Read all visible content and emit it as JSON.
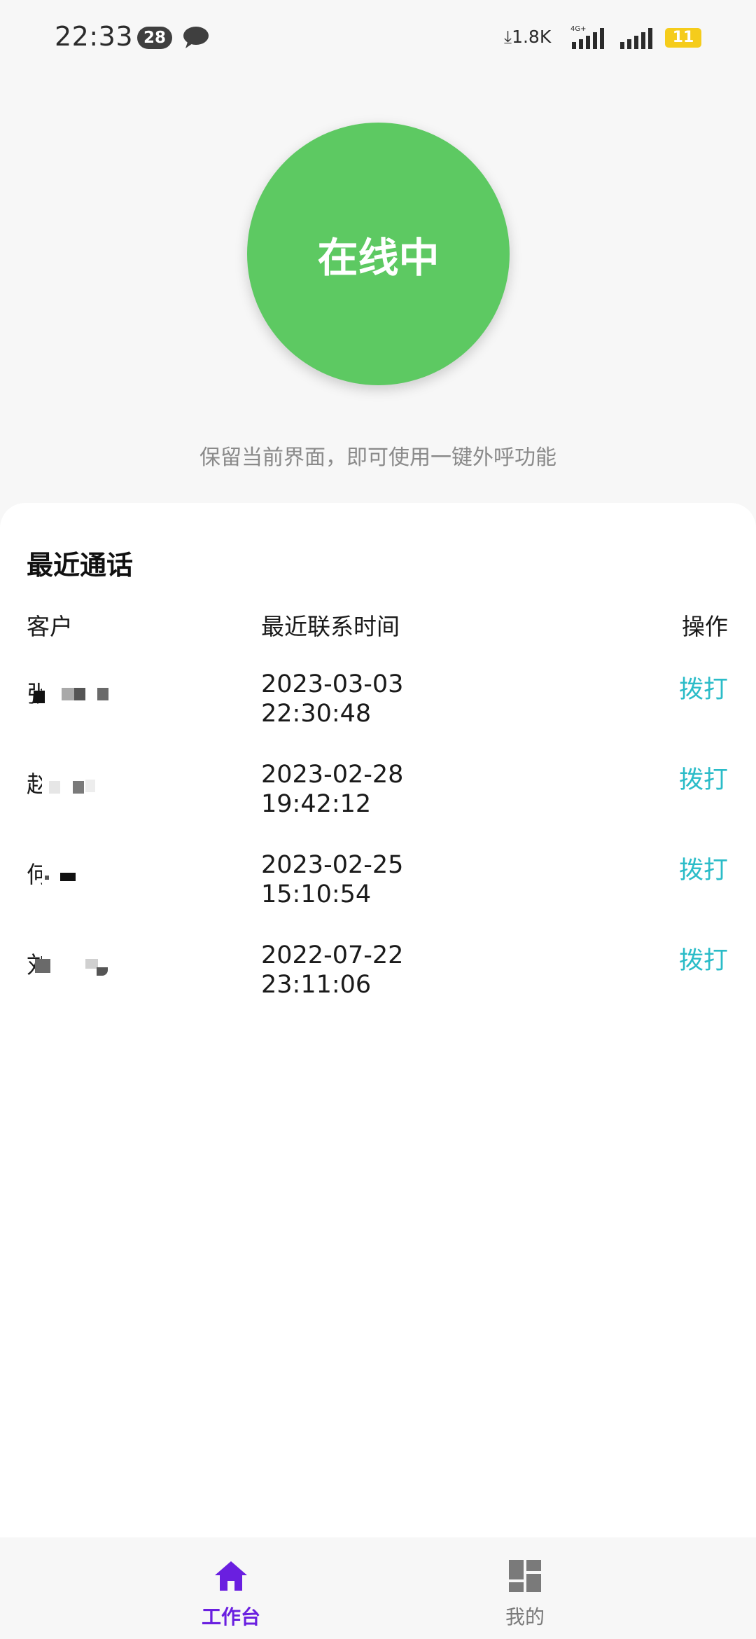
{
  "status_bar": {
    "time": "22:33",
    "notification_count": "28",
    "net_speed": "1.8K",
    "battery": "11"
  },
  "status": {
    "online_label": "在线中",
    "hint": "保留当前界面，即可使用一键外呼功能"
  },
  "recent_calls": {
    "title": "最近通话",
    "headers": {
      "customer": "客户",
      "time": "最近联系时间",
      "action": "操作"
    },
    "rows": [
      {
        "customer_initial": "张",
        "date": "2023-03-03",
        "clock": "22:30:48",
        "action": "拨打"
      },
      {
        "customer_initial": "赵",
        "date": "2023-02-28",
        "clock": "19:42:12",
        "action": "拨打"
      },
      {
        "customer_initial": "何",
        "date": "2023-02-25",
        "clock": "15:10:54",
        "action": "拨打"
      },
      {
        "customer_initial": "刘",
        "date": "2022-07-22",
        "clock": "23:11:06",
        "action": "拨打"
      }
    ]
  },
  "bottom_nav": {
    "items": [
      {
        "label": "工作台",
        "icon": "home-icon",
        "active": true
      },
      {
        "label": "我的",
        "icon": "dashboard-icon",
        "active": false
      }
    ],
    "active_color": "#6a1fe0",
    "inactive_color": "#7a7a7a"
  },
  "colors": {
    "online_green": "#5dc962",
    "dial_teal": "#2bbcc8"
  }
}
